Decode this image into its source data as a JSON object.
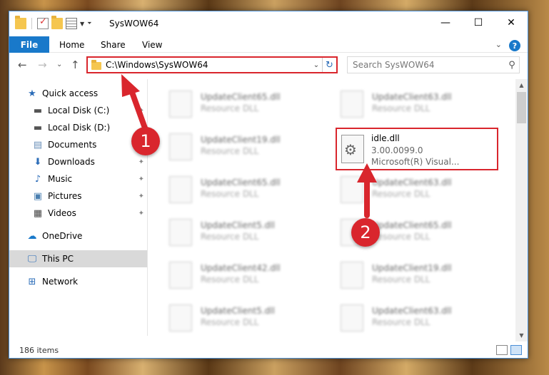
{
  "window": {
    "title": "SysWOW64"
  },
  "window_buttons": {
    "minimize": "—",
    "maximize": "☐",
    "close": "✕"
  },
  "ribbon": {
    "tabs": [
      "File",
      "Home",
      "Share",
      "View"
    ],
    "collapse_glyph": "⌄",
    "help_glyph": "?"
  },
  "nav": {
    "back": "←",
    "forward": "→",
    "recent": "⌄",
    "up": "↑"
  },
  "address": {
    "path": "C:\\Windows\\SysWOW64",
    "dropdown": "⌄",
    "refresh": "↻"
  },
  "search": {
    "placeholder": "Search SysWOW64"
  },
  "sidebar": {
    "items": [
      {
        "label": "Quick access",
        "icon": "star-icon",
        "pinned": false
      },
      {
        "label": "Local Disk (C:)",
        "icon": "drive-icon",
        "pinned": true
      },
      {
        "label": "Local Disk (D:)",
        "icon": "drive-icon",
        "pinned": false
      },
      {
        "label": "Documents",
        "icon": "documents-icon",
        "pinned": true
      },
      {
        "label": "Downloads",
        "icon": "downloads-icon",
        "pinned": true
      },
      {
        "label": "Music",
        "icon": "music-icon",
        "pinned": true
      },
      {
        "label": "Pictures",
        "icon": "pictures-icon",
        "pinned": true
      },
      {
        "label": "Videos",
        "icon": "videos-icon",
        "pinned": true
      },
      {
        "label": "OneDrive",
        "icon": "onedrive-icon",
        "pinned": false
      },
      {
        "label": "This PC",
        "icon": "computer-icon",
        "pinned": false,
        "selected": true
      },
      {
        "label": "Network",
        "icon": "network-icon",
        "pinned": false
      }
    ]
  },
  "files": {
    "left_column": [
      {
        "name": "UpdateClient65.dll",
        "type": "Resource DLL"
      },
      {
        "name": "UpdateClient19.dll",
        "type": "Resource DLL"
      },
      {
        "name": "UpdateClient65.dll",
        "type": "Resource DLL"
      },
      {
        "name": "UpdateClient5.dll",
        "type": "Resource DLL"
      },
      {
        "name": "UpdateClient42.dll",
        "type": "Resource DLL"
      },
      {
        "name": "UpdateClient5.dll",
        "type": "Resource DLL"
      }
    ],
    "right_column": [
      {
        "name": "UpdateClient63.dll",
        "type": "Resource DLL"
      },
      {
        "name": "UpdateClient63.dll",
        "type": "Resource DLL"
      },
      {
        "name": "UpdateClient65.dll",
        "type": "Resource DLL"
      },
      {
        "name": "UpdateClient19.dll",
        "type": "Resource DLL"
      },
      {
        "name": "UpdateClient63.dll",
        "type": "Resource DLL"
      }
    ],
    "highlighted": {
      "name": "idle.dll",
      "version": "3.00.0099.0",
      "description": "Microsoft(R) Visual..."
    }
  },
  "status": {
    "item_count": "186 items"
  },
  "callouts": [
    "1",
    "2"
  ],
  "colors": {
    "accent": "#1979ca",
    "highlight": "#d9262d",
    "selected": "#d9d9d9"
  }
}
